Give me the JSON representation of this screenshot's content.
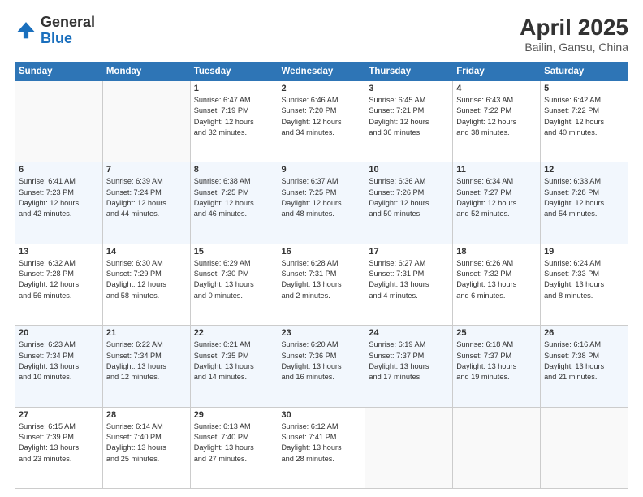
{
  "header": {
    "logo_line1": "General",
    "logo_line2": "Blue",
    "month_year": "April 2025",
    "location": "Bailin, Gansu, China"
  },
  "weekdays": [
    "Sunday",
    "Monday",
    "Tuesday",
    "Wednesday",
    "Thursday",
    "Friday",
    "Saturday"
  ],
  "weeks": [
    [
      {
        "day": "",
        "info": ""
      },
      {
        "day": "",
        "info": ""
      },
      {
        "day": "1",
        "info": "Sunrise: 6:47 AM\nSunset: 7:19 PM\nDaylight: 12 hours\nand 32 minutes."
      },
      {
        "day": "2",
        "info": "Sunrise: 6:46 AM\nSunset: 7:20 PM\nDaylight: 12 hours\nand 34 minutes."
      },
      {
        "day": "3",
        "info": "Sunrise: 6:45 AM\nSunset: 7:21 PM\nDaylight: 12 hours\nand 36 minutes."
      },
      {
        "day": "4",
        "info": "Sunrise: 6:43 AM\nSunset: 7:22 PM\nDaylight: 12 hours\nand 38 minutes."
      },
      {
        "day": "5",
        "info": "Sunrise: 6:42 AM\nSunset: 7:22 PM\nDaylight: 12 hours\nand 40 minutes."
      }
    ],
    [
      {
        "day": "6",
        "info": "Sunrise: 6:41 AM\nSunset: 7:23 PM\nDaylight: 12 hours\nand 42 minutes."
      },
      {
        "day": "7",
        "info": "Sunrise: 6:39 AM\nSunset: 7:24 PM\nDaylight: 12 hours\nand 44 minutes."
      },
      {
        "day": "8",
        "info": "Sunrise: 6:38 AM\nSunset: 7:25 PM\nDaylight: 12 hours\nand 46 minutes."
      },
      {
        "day": "9",
        "info": "Sunrise: 6:37 AM\nSunset: 7:25 PM\nDaylight: 12 hours\nand 48 minutes."
      },
      {
        "day": "10",
        "info": "Sunrise: 6:36 AM\nSunset: 7:26 PM\nDaylight: 12 hours\nand 50 minutes."
      },
      {
        "day": "11",
        "info": "Sunrise: 6:34 AM\nSunset: 7:27 PM\nDaylight: 12 hours\nand 52 minutes."
      },
      {
        "day": "12",
        "info": "Sunrise: 6:33 AM\nSunset: 7:28 PM\nDaylight: 12 hours\nand 54 minutes."
      }
    ],
    [
      {
        "day": "13",
        "info": "Sunrise: 6:32 AM\nSunset: 7:28 PM\nDaylight: 12 hours\nand 56 minutes."
      },
      {
        "day": "14",
        "info": "Sunrise: 6:30 AM\nSunset: 7:29 PM\nDaylight: 12 hours\nand 58 minutes."
      },
      {
        "day": "15",
        "info": "Sunrise: 6:29 AM\nSunset: 7:30 PM\nDaylight: 13 hours\nand 0 minutes."
      },
      {
        "day": "16",
        "info": "Sunrise: 6:28 AM\nSunset: 7:31 PM\nDaylight: 13 hours\nand 2 minutes."
      },
      {
        "day": "17",
        "info": "Sunrise: 6:27 AM\nSunset: 7:31 PM\nDaylight: 13 hours\nand 4 minutes."
      },
      {
        "day": "18",
        "info": "Sunrise: 6:26 AM\nSunset: 7:32 PM\nDaylight: 13 hours\nand 6 minutes."
      },
      {
        "day": "19",
        "info": "Sunrise: 6:24 AM\nSunset: 7:33 PM\nDaylight: 13 hours\nand 8 minutes."
      }
    ],
    [
      {
        "day": "20",
        "info": "Sunrise: 6:23 AM\nSunset: 7:34 PM\nDaylight: 13 hours\nand 10 minutes."
      },
      {
        "day": "21",
        "info": "Sunrise: 6:22 AM\nSunset: 7:34 PM\nDaylight: 13 hours\nand 12 minutes."
      },
      {
        "day": "22",
        "info": "Sunrise: 6:21 AM\nSunset: 7:35 PM\nDaylight: 13 hours\nand 14 minutes."
      },
      {
        "day": "23",
        "info": "Sunrise: 6:20 AM\nSunset: 7:36 PM\nDaylight: 13 hours\nand 16 minutes."
      },
      {
        "day": "24",
        "info": "Sunrise: 6:19 AM\nSunset: 7:37 PM\nDaylight: 13 hours\nand 17 minutes."
      },
      {
        "day": "25",
        "info": "Sunrise: 6:18 AM\nSunset: 7:37 PM\nDaylight: 13 hours\nand 19 minutes."
      },
      {
        "day": "26",
        "info": "Sunrise: 6:16 AM\nSunset: 7:38 PM\nDaylight: 13 hours\nand 21 minutes."
      }
    ],
    [
      {
        "day": "27",
        "info": "Sunrise: 6:15 AM\nSunset: 7:39 PM\nDaylight: 13 hours\nand 23 minutes."
      },
      {
        "day": "28",
        "info": "Sunrise: 6:14 AM\nSunset: 7:40 PM\nDaylight: 13 hours\nand 25 minutes."
      },
      {
        "day": "29",
        "info": "Sunrise: 6:13 AM\nSunset: 7:40 PM\nDaylight: 13 hours\nand 27 minutes."
      },
      {
        "day": "30",
        "info": "Sunrise: 6:12 AM\nSunset: 7:41 PM\nDaylight: 13 hours\nand 28 minutes."
      },
      {
        "day": "",
        "info": ""
      },
      {
        "day": "",
        "info": ""
      },
      {
        "day": "",
        "info": ""
      }
    ]
  ]
}
